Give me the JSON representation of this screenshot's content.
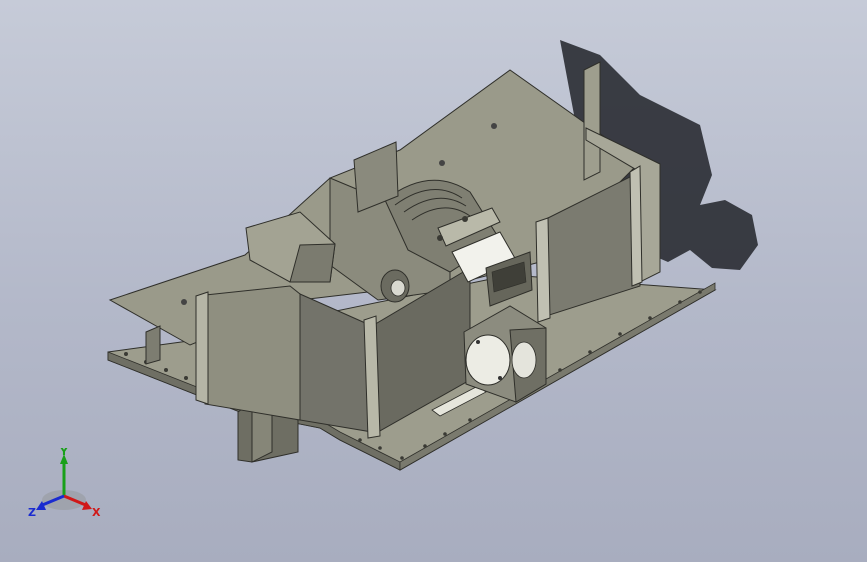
{
  "viewport": {
    "background_top": "#c6cbd8",
    "background_bottom": "#a8adbf"
  },
  "model": {
    "part_color": "#9a9a8a",
    "part_shade": "#6d6d62",
    "part_light": "#b9b9aa",
    "shadow_color": "#2a2c33"
  },
  "triad": {
    "x_label": "X",
    "y_label": "Y",
    "z_label": "Z",
    "x_color": "#d01818",
    "y_color": "#19a019",
    "z_color": "#1a2bd0"
  }
}
